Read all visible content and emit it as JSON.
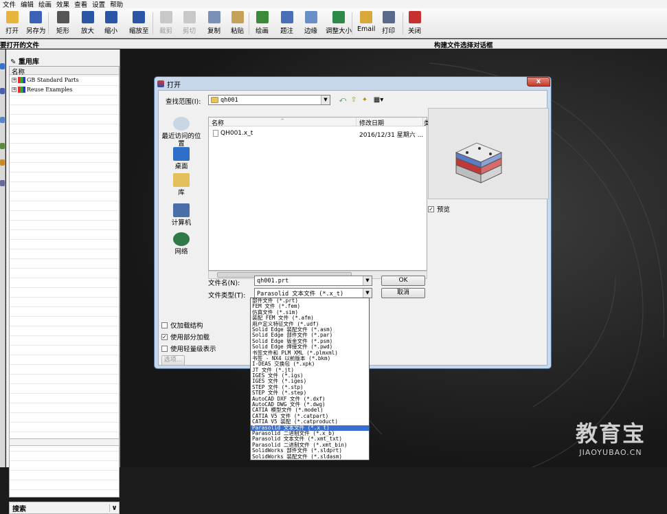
{
  "menu": [
    "文件",
    "编辑",
    "绘画",
    "效果",
    "查看",
    "设置",
    "帮助"
  ],
  "toolbar": {
    "items": [
      {
        "label": "打开",
        "icon": "open-folder-icon",
        "enabled": true
      },
      {
        "label": "另存为",
        "icon": "save-icon",
        "enabled": true
      },
      {
        "label": "矩形",
        "icon": "rect-select-icon",
        "enabled": true
      },
      {
        "label": "放大",
        "icon": "zoom-in-icon",
        "enabled": true
      },
      {
        "label": "缩小",
        "icon": "zoom-out-icon",
        "enabled": true
      },
      {
        "label": "缩放至",
        "icon": "zoom-to-icon",
        "enabled": true
      },
      {
        "label": "裁剪",
        "icon": "crop-icon",
        "enabled": false
      },
      {
        "label": "剪切",
        "icon": "cut-icon",
        "enabled": false
      },
      {
        "label": "复制",
        "icon": "copy-icon",
        "enabled": true
      },
      {
        "label": "粘贴",
        "icon": "paste-icon",
        "enabled": true
      },
      {
        "label": "绘画",
        "icon": "paint-icon",
        "enabled": true
      },
      {
        "label": "题注",
        "icon": "caption-icon",
        "enabled": true
      },
      {
        "label": "边缘",
        "icon": "border-icon",
        "enabled": true
      },
      {
        "label": "调整大小",
        "icon": "resize-icon",
        "enabled": true
      },
      {
        "label": "Email",
        "icon": "email-icon",
        "enabled": true
      },
      {
        "label": "打印",
        "icon": "print-icon",
        "enabled": true
      },
      {
        "label": "关闭",
        "icon": "power-icon",
        "enabled": true
      }
    ]
  },
  "title_left": "要打开的文件",
  "title_right": "构建文件选择对话框",
  "left_panel": {
    "title": "重用库",
    "column": "名称",
    "items": [
      "GB Standard Parts",
      "Reuse Examples"
    ],
    "search_label": "搜索"
  },
  "dialog": {
    "title": "打开",
    "close": "x",
    "lookin_label": "查找范围(I):",
    "lookin_value": "qh001",
    "places": [
      {
        "label": "最近访问的位置"
      },
      {
        "label": "桌面"
      },
      {
        "label": "库"
      },
      {
        "label": "计算机"
      },
      {
        "label": "网络"
      }
    ],
    "columns": {
      "name": "名称",
      "date": "修改日期",
      "extra": "类"
    },
    "files": [
      {
        "name": "QH001.x_t",
        "date": "2016/12/31 星期六 ..."
      }
    ],
    "filename_label": "文件名(N):",
    "filename_value": "qh001.prt",
    "filetype_label": "文件类型(T):",
    "filetype_value": "Parasolid 文本文件 (*.x_t)",
    "ok": "OK",
    "cancel": "取消",
    "preview_label": "预览",
    "preview_checked": true,
    "options": [
      {
        "label": "仅加载结构",
        "checked": false
      },
      {
        "label": "使用部分加载",
        "checked": true
      },
      {
        "label": "使用轻量级表示",
        "checked": false
      }
    ],
    "options_button": "选项...",
    "filetypes": [
      "部件文件 (*.prt)",
      "FEM 文件 (*.fem)",
      "仿真文件 (*.sim)",
      "装配 FEM 文件 (*.afm)",
      "用户定义特征文件 (*.udf)",
      "Solid Edge 装配文件 (*.asm)",
      "Solid Edge 部件文件 (*.par)",
      "Solid Edge 钣金文件 (*.psm)",
      "Solid Edge 焊接文件 (*.pwd)",
      "书签文件和 PLM XML (*.plmxml)",
      "书签 - NX4 以前版本 (*.bkm)",
      "I-DEAS 交换包 (*.xpk)",
      "JT 文件 (*.jt)",
      "IGES 文件 (*.igs)",
      "IGES 文件 (*.iges)",
      "STEP 文件 (*.stp)",
      "STEP 文件 (*.step)",
      "AutoCAD DXF 文件 (*.dxf)",
      "AutoCAD DWG 文件 (*.dwg)",
      "CATIA 模型文件 (*.model)",
      "CATIA V5 文件 (*.catpart)",
      "CATIA V5 装配 (*.catproduct)",
      "Parasolid 文本文件 (*.x_t)",
      "Parasolid 二进制文件 (*.x_b)",
      "Parasolid 文本文件 (*.xmt_txt)",
      "Parasolid 二进制文件 (*.xmt_bin)",
      "SolidWorks 部件文件 (*.sldprt)",
      "SolidWorks 装配文件 (*.sldasm)"
    ],
    "selected_type": "Parasolid 文本文件 (*.x_t)"
  },
  "watermark": {
    "big": "教育宝",
    "small": "JIAOYUBAO.CN"
  }
}
